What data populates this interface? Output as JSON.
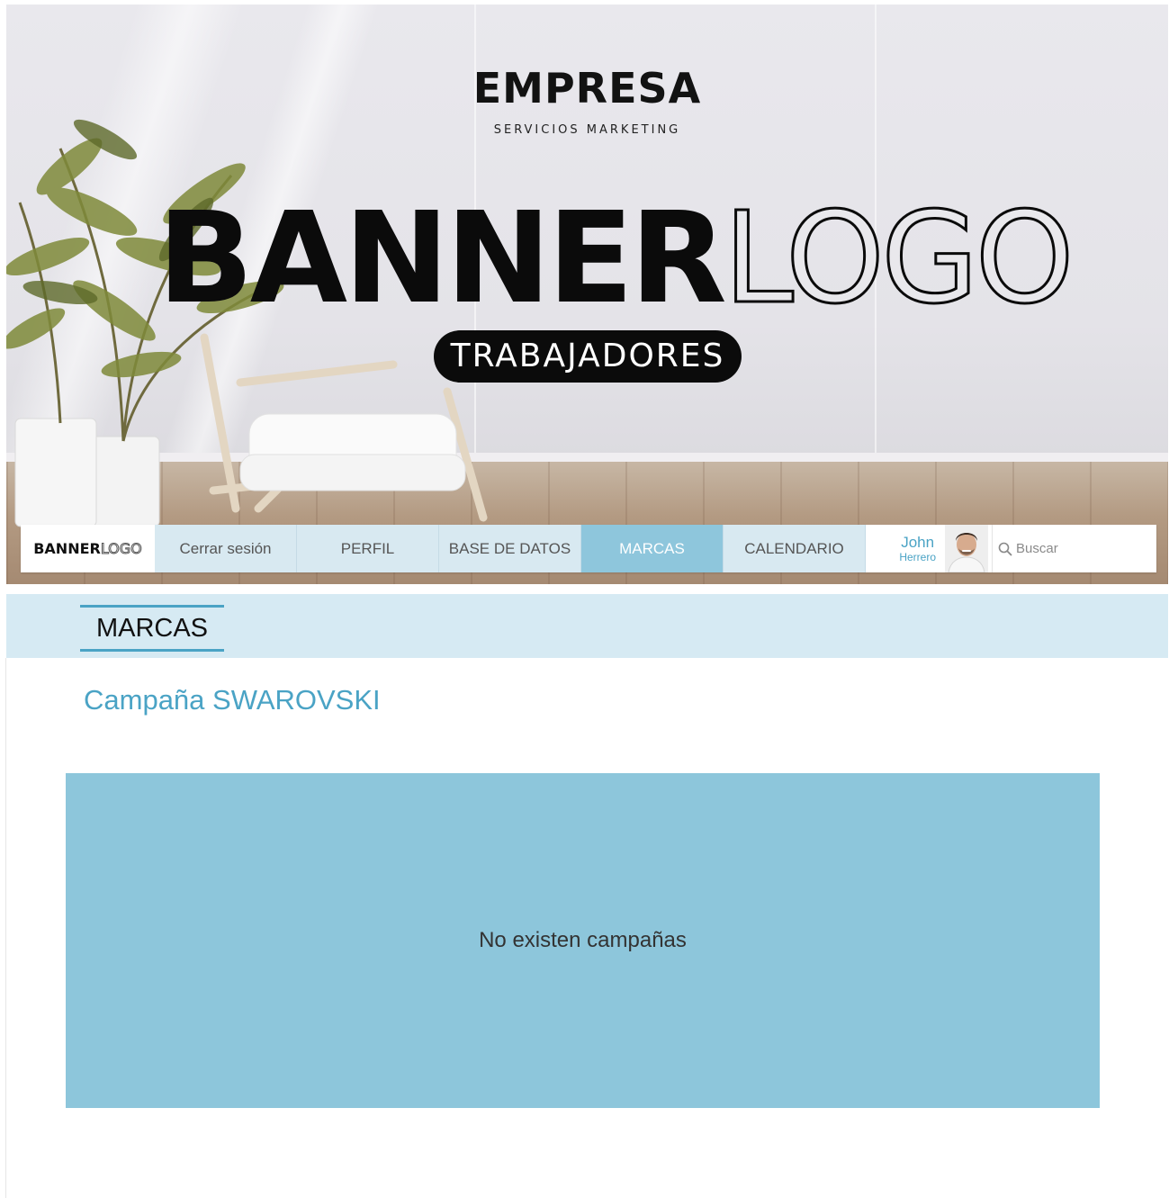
{
  "hero": {
    "company": "EMPRESA",
    "tagline": "SERVICIOS MARKETING",
    "logo_solid": "BANNER",
    "logo_outline": "LOGO",
    "badge": "TRABAJADORES"
  },
  "navbar": {
    "logo_solid": "BANNER",
    "logo_outline": "LOGO",
    "items": [
      {
        "label": "Cerrar sesión",
        "active": false
      },
      {
        "label": "PERFIL",
        "active": false
      },
      {
        "label": "BASE DE DATOS",
        "active": false
      },
      {
        "label": "MARCAS",
        "active": true
      },
      {
        "label": "CALENDARIO",
        "active": false
      }
    ],
    "user": {
      "first_name": "John",
      "last_name": "Herrero"
    },
    "search": {
      "placeholder": "Buscar"
    }
  },
  "section": {
    "title": "MARCAS"
  },
  "content": {
    "campaign_title": "Campaña SWAROVSKI",
    "empty_message": "No existen campañas"
  },
  "colors": {
    "accent": "#4aa3c5",
    "active_tab": "#8ec6dc",
    "section_bg": "#d6eaf3",
    "empty_box": "#8dc6db"
  }
}
